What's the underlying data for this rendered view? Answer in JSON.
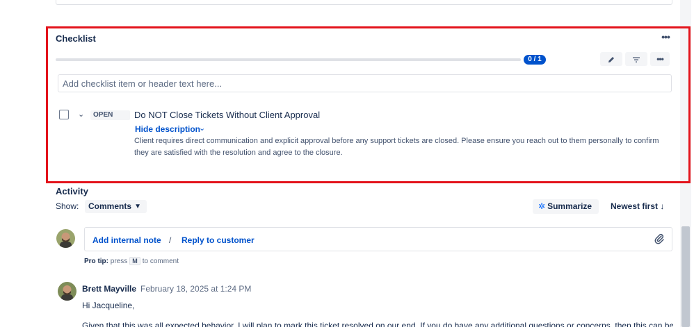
{
  "checklist": {
    "title": "Checklist",
    "more_icon": "more-horizontal-icon",
    "progress": {
      "label": "0 / 1",
      "completed": 0,
      "total": 1
    },
    "toolbar": {
      "edit_icon": "pencil-icon",
      "filter_icon": "filter-icon",
      "more_icon": "more-horizontal-icon"
    },
    "add_input": {
      "placeholder": "Add checklist item or header text here...",
      "value": ""
    },
    "items": [
      {
        "status": "OPEN",
        "checked": false,
        "title": "Do NOT Close Tickets Without Client Approval",
        "toggle_label": "Hide description",
        "description": "Client requires direct communication and explicit approval before any support tickets are closed. Please ensure you reach out to them personally to confirm they are satisfied with the resolution and agree to the closure."
      }
    ]
  },
  "activity": {
    "heading": "Activity",
    "show_label": "Show:",
    "show_value": "Comments",
    "summarize_label": "Summarize",
    "sort_label": "Newest first",
    "composer": {
      "internal_note": "Add internal note",
      "separator": "/",
      "reply": "Reply to customer",
      "attach_icon": "paperclip-icon"
    },
    "protip": {
      "label": "Pro tip:",
      "text_before": "press",
      "key": "M",
      "text_after": "to comment"
    },
    "comments": [
      {
        "author": "Brett Mayville",
        "date": "February 18, 2025 at 1:24 PM",
        "greeting": "Hi Jacqueline,",
        "body": "Given that this was all expected behavior, I will plan to mark this ticket resolved on our end. If you do have any additional questions or concerns, then this can be"
      }
    ]
  },
  "colors": {
    "highlight": "#e3131b",
    "accent": "#0052cc",
    "text": "#172b4d"
  }
}
